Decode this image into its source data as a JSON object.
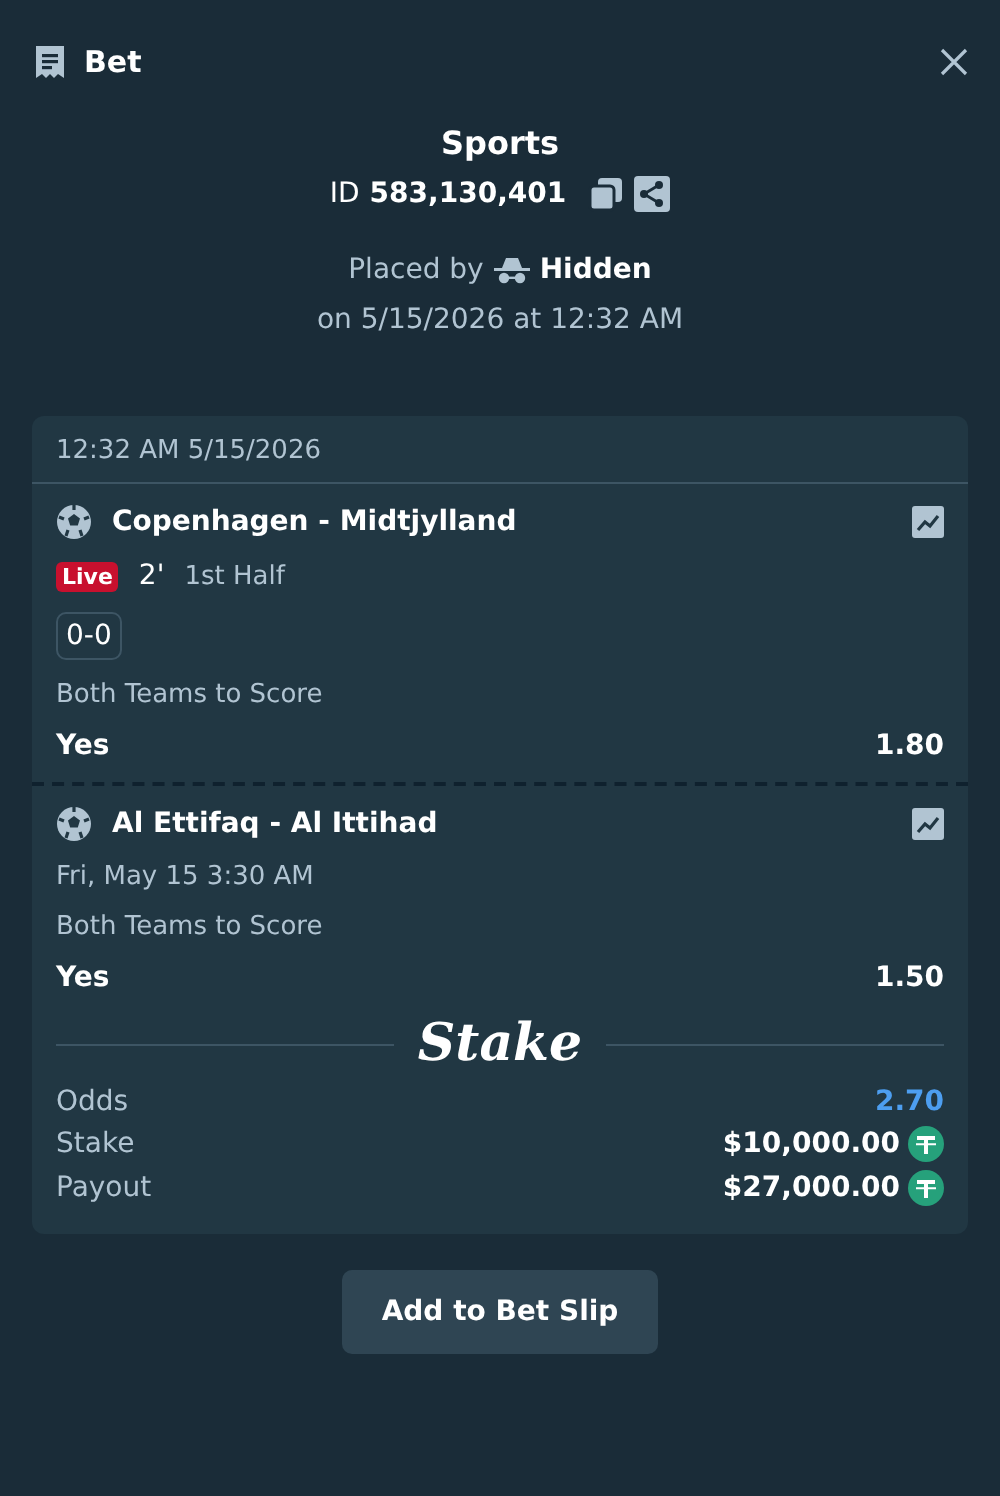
{
  "header": {
    "title": "Bet"
  },
  "summary": {
    "category": "Sports",
    "id_label": "ID",
    "id_value": "583,130,401",
    "placed_by_label": "Placed by",
    "placed_by_user": "Hidden",
    "placed_on": "on 5/15/2026 at 12:32 AM"
  },
  "slip": {
    "timestamp": "12:32 AM 5/15/2026",
    "legs": [
      {
        "event": "Copenhagen - Midtjylland",
        "live_badge": "Live",
        "minute": "2'",
        "period": "1st Half",
        "score": "0-0",
        "market": "Both Teams to Score",
        "outcome": "Yes",
        "odds": "1.80"
      },
      {
        "event": "Al Ettifaq - Al Ittihad",
        "start_time": "Fri, May 15  3:30 AM",
        "market": "Both Teams to Score",
        "outcome": "Yes",
        "odds": "1.50"
      }
    ],
    "logo": "Stake",
    "totals": [
      {
        "label": "Odds",
        "value": "2.70",
        "kind": "odds"
      },
      {
        "label": "Stake",
        "value": "$10,000.00",
        "kind": "money"
      },
      {
        "label": "Payout",
        "value": "$27,000.00",
        "kind": "money"
      }
    ]
  },
  "button": "Add to Bet Slip"
}
